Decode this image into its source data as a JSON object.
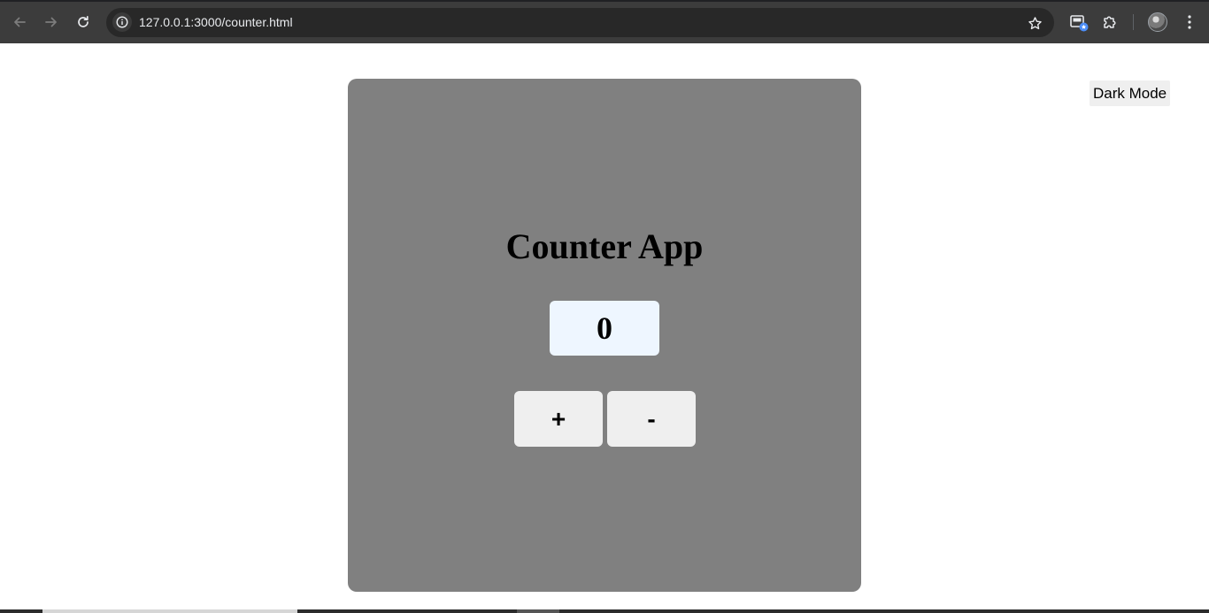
{
  "browser": {
    "url": "127.0.0.1:3000/counter.html",
    "icons": {
      "back": "arrow-left-icon",
      "forward": "arrow-right-icon",
      "reload": "reload-icon",
      "site_info": "info-icon",
      "bookmark": "star-icon",
      "cast": "cast-icon",
      "extensions": "puzzle-icon",
      "profile": "avatar",
      "menu": "kebab-menu-icon"
    }
  },
  "page": {
    "dark_mode_label": "Dark Mode",
    "app": {
      "title": "Counter App",
      "count": "0",
      "increment_label": "+",
      "decrement_label": "-"
    }
  },
  "colors": {
    "card_bg": "#808080",
    "count_bg": "#eef6ff",
    "button_bg": "#efefef",
    "chrome_bg": "#3c3c3c",
    "omnibox_bg": "#282828"
  }
}
